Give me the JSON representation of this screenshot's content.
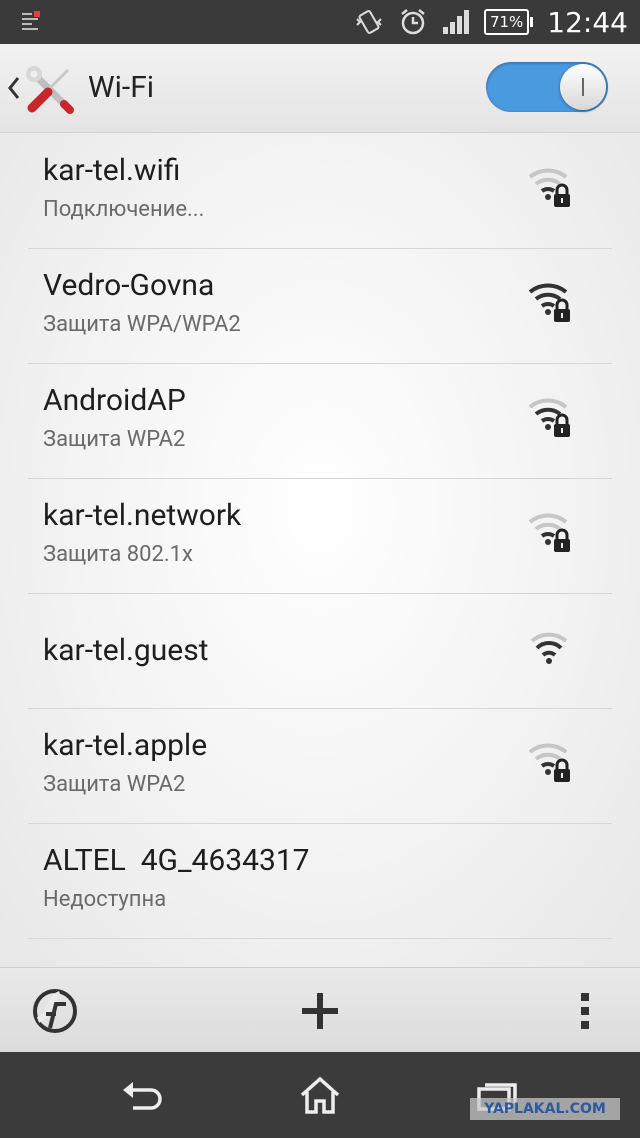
{
  "status_bar": {
    "battery": "71%",
    "time": "12:44",
    "icons": [
      "notification-list-icon",
      "vibrate-icon",
      "alarm-icon",
      "signal-icon",
      "battery-icon"
    ]
  },
  "action_bar": {
    "title": "Wi-Fi",
    "app_icon": "settings-tools-icon",
    "wifi_enabled": true
  },
  "networks": [
    {
      "name": "kar-tel.wifi",
      "status": "Подключение...",
      "secured": true,
      "signal": "weak"
    },
    {
      "name": "Vedro-Govna",
      "status": "Защита WPA/WPA2",
      "secured": true,
      "signal": "strong"
    },
    {
      "name": "AndroidAP",
      "status": "Защита WPA2",
      "secured": true,
      "signal": "medium"
    },
    {
      "name": "kar-tel.network",
      "status": "Защита 802.1x",
      "secured": true,
      "signal": "weak"
    },
    {
      "name": "kar-tel.guest",
      "status": "",
      "secured": false,
      "signal": "medium"
    },
    {
      "name": "kar-tel.apple",
      "status": "Защита WPA2",
      "secured": true,
      "signal": "weak"
    },
    {
      "name": "ALTEL  4G_4634317",
      "status": "Недоступна",
      "secured": false,
      "signal": "none"
    }
  ],
  "toolbar": {
    "icons": [
      "wps-icon",
      "add-network-icon",
      "overflow-menu-icon"
    ]
  },
  "nav_bar": {
    "icons": [
      "back-icon",
      "home-icon",
      "recent-apps-icon"
    ]
  },
  "watermark": "YAPLAKAL.COM"
}
